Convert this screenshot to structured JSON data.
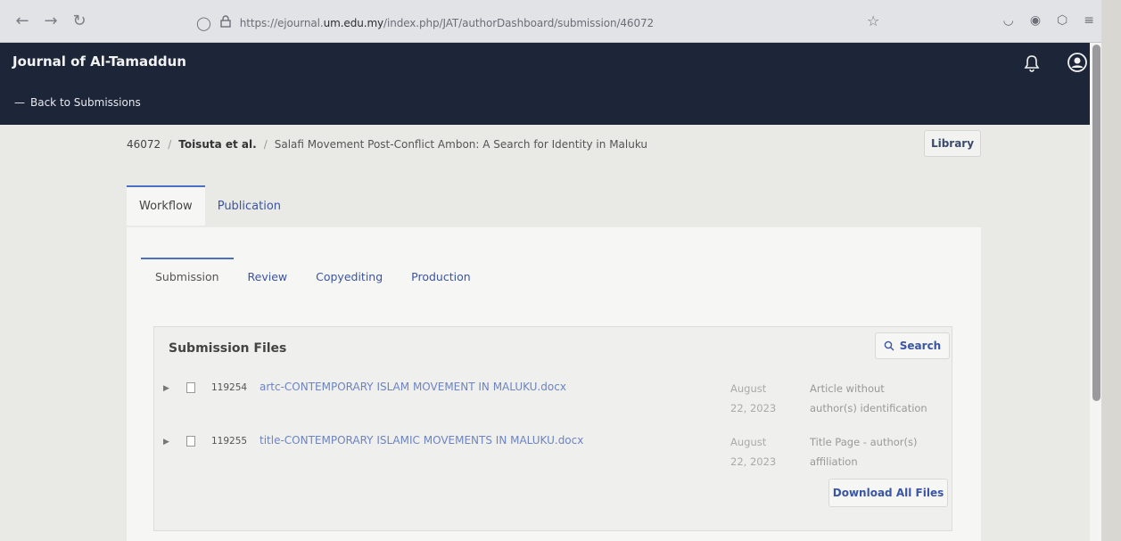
{
  "browser": {
    "url_prefix": "https://ejournal.",
    "url_domain": "um.edu.my",
    "url_path": "/index.php/JAT/authorDashboard/submission/46072"
  },
  "header": {
    "journal_title": "Journal of Al-Tamaddun",
    "back_link": "Back to Submissions"
  },
  "breadcrumb": {
    "id": "46072",
    "separator": "/",
    "authors": "Toisuta et al.",
    "title": "Salafi Movement Post-Conflict Ambon: A Search for Identity in Maluku"
  },
  "library_button": "Library",
  "top_tabs": [
    {
      "label": "Workflow"
    },
    {
      "label": "Publication"
    }
  ],
  "sub_tabs": [
    {
      "label": "Submission"
    },
    {
      "label": "Review"
    },
    {
      "label": "Copyediting"
    },
    {
      "label": "Production"
    }
  ],
  "files": {
    "title": "Submission Files",
    "search_label": "Search",
    "download_all_label": "Download All Files",
    "rows": [
      {
        "id": "119254",
        "name": "artc-CONTEMPORARY ISLAM MOVEMENT IN MALUKU.docx",
        "date_line1": "August",
        "date_line2": "22, 2023",
        "type_line1": "Article without",
        "type_line2": "author(s) identification"
      },
      {
        "id": "119255",
        "name": "title-CONTEMPORARY ISLAMIC MOVEMENTS IN MALUKU.docx",
        "date_line1": "August",
        "date_line2": "22, 2023",
        "type_line1": "Title Page - author(s)",
        "type_line2": "affiliation"
      }
    ]
  },
  "colors": {
    "header_bg": "#1d2638",
    "accent_blue": "#3a55a3",
    "tab_indicator": "#4a6fc3"
  }
}
